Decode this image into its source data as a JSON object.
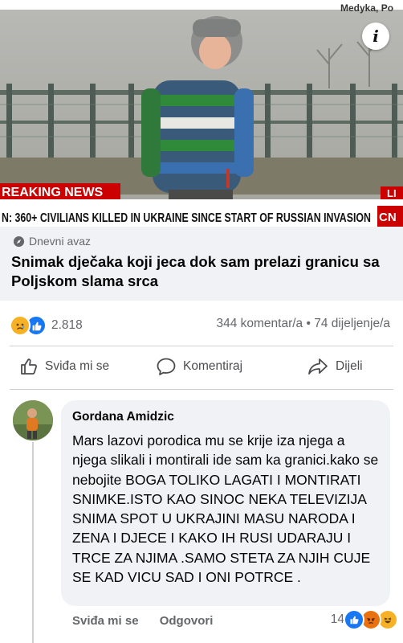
{
  "post": {
    "thumbnail": {
      "breaking_label": "REAKING NEWS",
      "ticker": "N: 360+ CIVILIANS KILLED IN UKRAINE SINCE START OF RUSSIAN INVASION",
      "location": "Medyka, Po",
      "network": "CN",
      "ticker_tag": "LI"
    },
    "info_glyph": "i",
    "source": "Dnevni avaz",
    "headline": "Snimak dječaka koji jeca dok sam prelazi granicu sa Poljskom slama srca"
  },
  "stats": {
    "reaction_count": "2.818",
    "comments_shares": "344 komentar/a • 74 dijeljenje/a",
    "reaction_icons": [
      "sad-emoji",
      "like-thumb"
    ]
  },
  "actions": {
    "like": "Sviđa mi se",
    "comment": "Komentiraj",
    "share": "Dijeli"
  },
  "comment": {
    "author": "Gordana Amidzic",
    "text": "Mars lazovi porodica mu se krije iza njega a njega slikali i montirali ide sam ka granici.kako se nebojite BOGA TOLIKO LAGATI I MONTIRATI SNIMKE.ISTO KAO SINOC NEKA TELEVIZIJA SNIMA SPOT U UKRAJINI MASU NARODA I ZENA I DJECE I KAKO IH RUSI UDARAJU I TRCE ZA NJIMA .SAMO STETA ZA NJIH CUJE SE KAD VICU SAD  I ONI POTRCE .",
    "like_label": "Sviđa mi se",
    "reply_label": "Odgovori",
    "reaction_count": "14",
    "reaction_icons": [
      "like-thumb",
      "angry-emoji",
      "laugh-emoji"
    ]
  },
  "colors": {
    "facebook_blue": "#1877f2",
    "breaking_red": "#cc0000",
    "bubble_gray": "#f0f2f5",
    "muted_text": "#65676b"
  }
}
